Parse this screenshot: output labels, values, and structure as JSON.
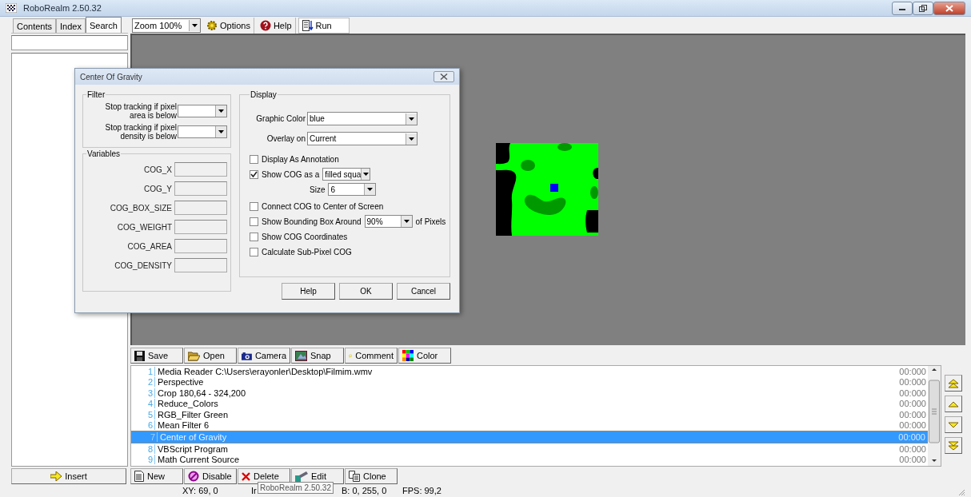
{
  "window": {
    "title": "RoboRealm 2.50.32"
  },
  "help_tabs": [
    {
      "label": "Contents",
      "selected": false
    },
    {
      "label": "Index",
      "selected": false
    },
    {
      "label": "Search",
      "selected": true
    }
  ],
  "toolbar": {
    "zoom": "Zoom 100%",
    "buttons": [
      {
        "kind": "gear",
        "label": "Options"
      },
      {
        "kind": "help",
        "label": "Help"
      },
      {
        "kind": "run",
        "label": "Run"
      }
    ]
  },
  "pipeline_toolbar": [
    {
      "kind": "save",
      "label": "Save"
    },
    {
      "kind": "open",
      "label": "Open"
    },
    {
      "kind": "camera",
      "label": "Camera"
    },
    {
      "kind": "snap",
      "label": "Snap"
    },
    {
      "kind": "comment",
      "label": "Comment"
    },
    {
      "kind": "color",
      "label": "Color"
    }
  ],
  "pipeline": [
    {
      "number": "1",
      "name": "Media Reader C:\\Users\\erayonler\\Desktop\\Filmim.wmv",
      "time": "00:000",
      "selected": false
    },
    {
      "number": "2",
      "name": "Perspective",
      "time": "00:000",
      "selected": false
    },
    {
      "number": "3",
      "name": "Crop 180,64 - 324,200",
      "time": "00:000",
      "selected": false
    },
    {
      "number": "4",
      "name": "Reduce_Colors",
      "time": "00:000",
      "selected": false
    },
    {
      "number": "5",
      "name": "RGB_Filter Green",
      "time": "00:000",
      "selected": false
    },
    {
      "number": "6",
      "name": "Mean Filter 6",
      "time": "00:000",
      "selected": false
    },
    {
      "number": "7",
      "name": "Center of Gravity",
      "time": "00:000",
      "selected": true
    },
    {
      "number": "8",
      "name": "VBScript Program",
      "time": "00:000",
      "selected": false
    },
    {
      "number": "9",
      "name": "Math Current Source",
      "time": "00:000",
      "selected": false
    }
  ],
  "insert_button": "Insert",
  "pipeline_buttons": [
    {
      "kind": "new",
      "label": "New"
    },
    {
      "kind": "disable",
      "label": "Disable"
    },
    {
      "kind": "delete",
      "label": "Delete"
    },
    {
      "kind": "edit",
      "label": "Edit"
    },
    {
      "kind": "clone",
      "label": "Clone"
    }
  ],
  "status_bar": [
    "XY: 69, 0",
    "Ir",
    "B: 0, 255, 0",
    "FPS: 99,2"
  ],
  "tooltip": "RoboRealm 2.50.32",
  "dialog": {
    "title": "Center Of Gravity",
    "filter": {
      "label": "Filter",
      "rows": [
        "Stop tracking if pixel area is below",
        "Stop tracking if pixel density is below"
      ]
    },
    "variables": {
      "label": "Variables",
      "items": [
        "COG_X",
        "COG_Y",
        "COG_BOX_SIZE",
        "COG_WEIGHT",
        "COG_AREA",
        "COG_DENSITY"
      ]
    },
    "display": {
      "label": "Display",
      "selects": [
        {
          "label": "Graphic Color",
          "value": "blue"
        },
        {
          "label": "Overlay on",
          "value": "Current"
        }
      ],
      "options": [
        {
          "kind": "checkbox",
          "label": "Display As Annotation",
          "checked": false
        },
        {
          "kind": "checkbox_select",
          "label": "Show COG as a",
          "checked": true,
          "value": "filled squa"
        },
        {
          "kind": "select",
          "label": "Size",
          "value": "6"
        },
        {
          "kind": "checkbox",
          "label": "Connect COG to Center of Screen",
          "checked": false
        },
        {
          "kind": "checkbox_select",
          "label": "Show Bounding Box Around",
          "checked": false,
          "value": "90%",
          "suffix": "of Pixels"
        },
        {
          "kind": "checkbox",
          "label": "Show COG Coordinates",
          "checked": false
        },
        {
          "kind": "checkbox",
          "label": "Calculate Sub-Pixel COG",
          "checked": false
        }
      ]
    },
    "buttons": [
      "Help",
      "OK",
      "Cancel"
    ]
  }
}
